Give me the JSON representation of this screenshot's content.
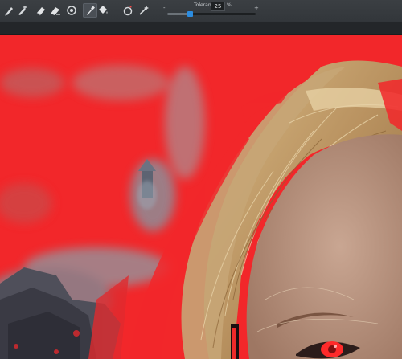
{
  "toolbar": {
    "tools": [
      {
        "icon": "pencil-brush-icon",
        "active": false
      },
      {
        "icon": "brush-plus-icon",
        "active": false
      },
      {
        "icon": "eraser-icon",
        "active": false
      },
      {
        "icon": "eraser-brush-icon",
        "active": false
      },
      {
        "icon": "refine-brush-icon",
        "active": false
      },
      {
        "icon": "color-picker-icon",
        "active": true
      },
      {
        "icon": "fill-icon",
        "active": false
      },
      {
        "icon": "selection-brush-icon",
        "active": false
      },
      {
        "icon": "magic-wand-icon",
        "active": false
      }
    ],
    "tolerance": {
      "label": "Tolerance",
      "value": "25",
      "unit": "%",
      "minus": "-",
      "plus": "+",
      "level": 0.25
    }
  },
  "canvas": {
    "mask_color": "#f2272a",
    "description_colors": {
      "hair": "#c9a66b",
      "skin": "#c29a86",
      "eye_glow": "#ff2a2a"
    }
  }
}
